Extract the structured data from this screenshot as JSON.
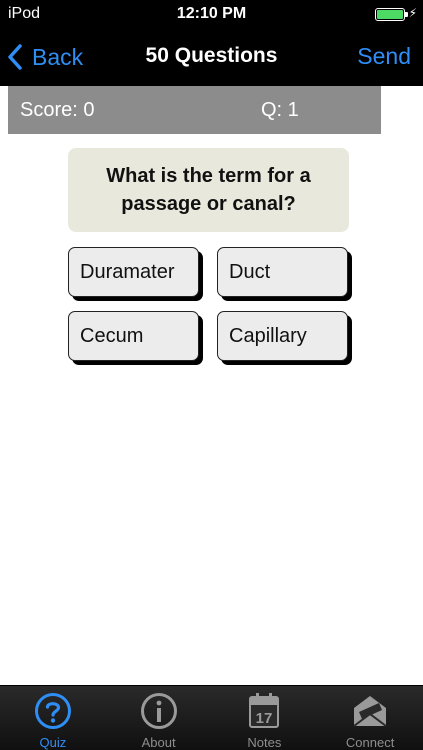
{
  "status_bar": {
    "carrier": "iPod",
    "time": "12:10 PM"
  },
  "nav": {
    "back_label": "Back",
    "title": "50 Questions",
    "send_label": "Send"
  },
  "score_bar": {
    "score": "Score: 0",
    "question": "Q: 1"
  },
  "question": {
    "text": "What is the term for a passage or canal?"
  },
  "answers": [
    {
      "label": "Duramater"
    },
    {
      "label": "Duct"
    },
    {
      "label": "Cecum"
    },
    {
      "label": "Capillary"
    }
  ],
  "tabs": [
    {
      "label": "Quiz",
      "icon": "question-circle-icon",
      "active": true
    },
    {
      "label": "About",
      "icon": "info-circle-icon",
      "active": false
    },
    {
      "label": "Notes",
      "icon": "calendar-icon",
      "calendar_day": "17",
      "active": false
    },
    {
      "label": "Connect",
      "icon": "envelope-icon",
      "active": false
    }
  ],
  "colors": {
    "accent": "#2f8ef4",
    "battery": "#4cd964",
    "score_bar": "#8c8c8c",
    "question_card": "#e8e9dc"
  }
}
